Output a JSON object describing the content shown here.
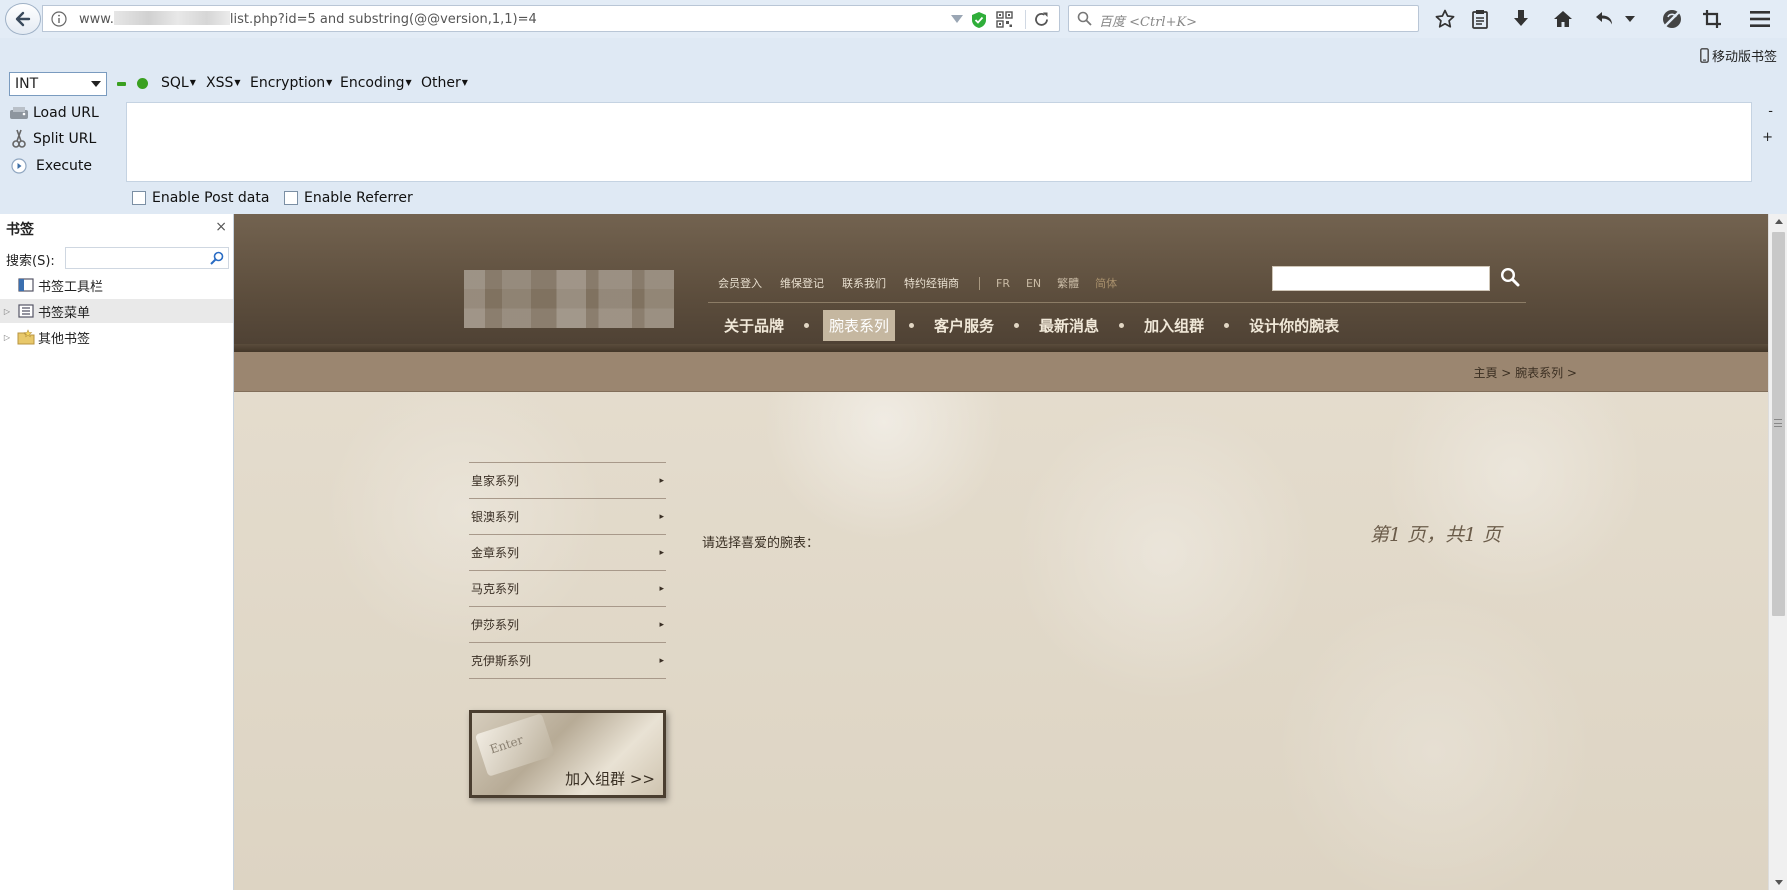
{
  "browser": {
    "url_prefix": "www.",
    "url_suffix": "list.php?id=5 and substring(@@version,1,1)=4",
    "search_placeholder": "百度 <Ctrl+K>",
    "mobile_bookmarks": "移动版书签"
  },
  "hackbar": {
    "type_select": "INT",
    "menus": [
      "SQL",
      "XSS",
      "Encryption",
      "Encoding",
      "Other"
    ],
    "actions": {
      "load": "Load URL",
      "split": "Split URL",
      "execute": "Execute"
    },
    "side_minus": "-",
    "side_plus": "+",
    "checks": {
      "post": "Enable Post data",
      "referrer": "Enable Referrer"
    }
  },
  "sidebar": {
    "title": "书签",
    "close": "×",
    "search_label": "搜索(S):",
    "items": [
      {
        "label": "书签工具栏"
      },
      {
        "label": "书签菜单"
      },
      {
        "label": "其他书签"
      }
    ]
  },
  "site": {
    "top_links": [
      "会员登入",
      "维保登记",
      "联系我们",
      "特约经销商"
    ],
    "languages": [
      "FR",
      "EN",
      "繁體",
      "简体"
    ],
    "nav": [
      "关于品牌",
      "腕表系列",
      "客户服务",
      "最新消息",
      "加入组群",
      "设计你的腕表"
    ],
    "breadcrumb": "主頁 > 腕表系列 >",
    "side_menu": [
      "皇家系列",
      "银澳系列",
      "金章系列",
      "马克系列",
      "伊莎系列",
      "克伊斯系列"
    ],
    "menu_arrow": "▸",
    "banner_text": "加入组群 >>",
    "banner_key": "Enter",
    "prompt": "请选择喜爱的腕表：",
    "pager": "第1 页，共1 页"
  },
  "colors": {
    "chrome": "#e3ecf6",
    "header_brown": "#5e4f3e",
    "crumb_bar": "#9b8670",
    "content_bg": "#e4dccd"
  }
}
